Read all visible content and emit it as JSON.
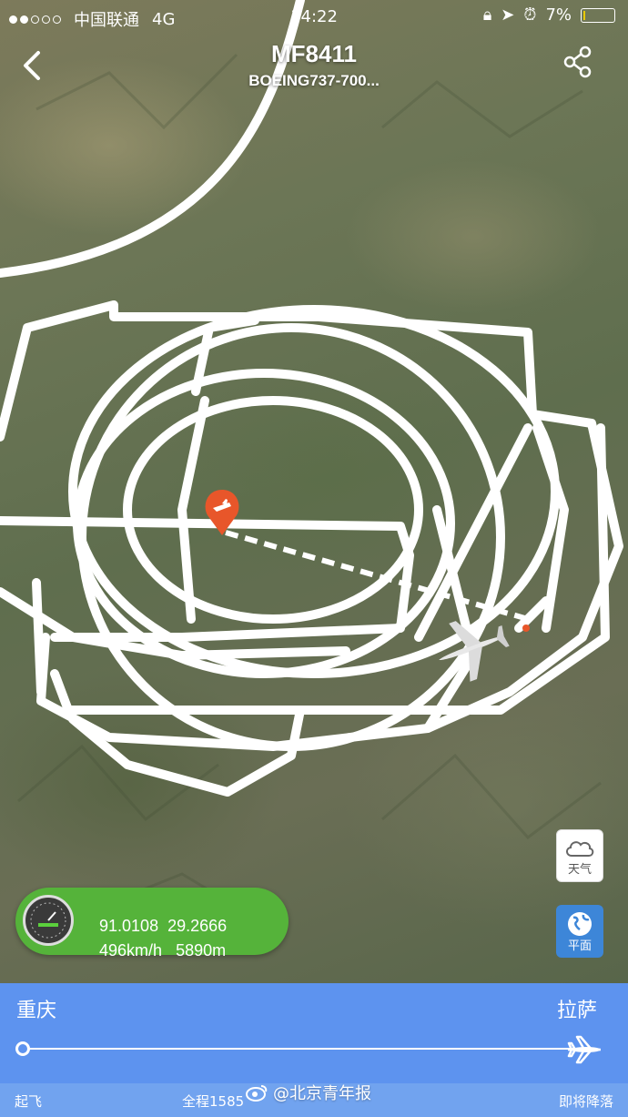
{
  "status_bar": {
    "carrier": "中国联通",
    "network": "4G",
    "time": "14:22",
    "battery": "7%",
    "battery_level": 0.07
  },
  "header": {
    "flight_number": "MF8411",
    "aircraft": "BOEING737-700..."
  },
  "map": {
    "style": "satellite",
    "track_color": "#ffffff",
    "airport_marker_color": "#e8562a",
    "icons": [
      "airport-pin-icon",
      "airplane-icon"
    ]
  },
  "flight_info": {
    "longitude": "91.0108",
    "latitude": "29.2666",
    "speed": "496km/h",
    "altitude": "5890m"
  },
  "map_controls": {
    "weather_label": "天气",
    "flat_label": "平面"
  },
  "route": {
    "from": "重庆",
    "to": "拉萨",
    "progress": 1.0
  },
  "footer": {
    "left": "起飞",
    "middle": "全程1585",
    "right": "即将降落"
  },
  "watermark": "@北京青年报",
  "colors": {
    "bottom_panel": "#5d93ef",
    "info_pill": "#55b33a",
    "flat_button": "#3d86d8"
  }
}
